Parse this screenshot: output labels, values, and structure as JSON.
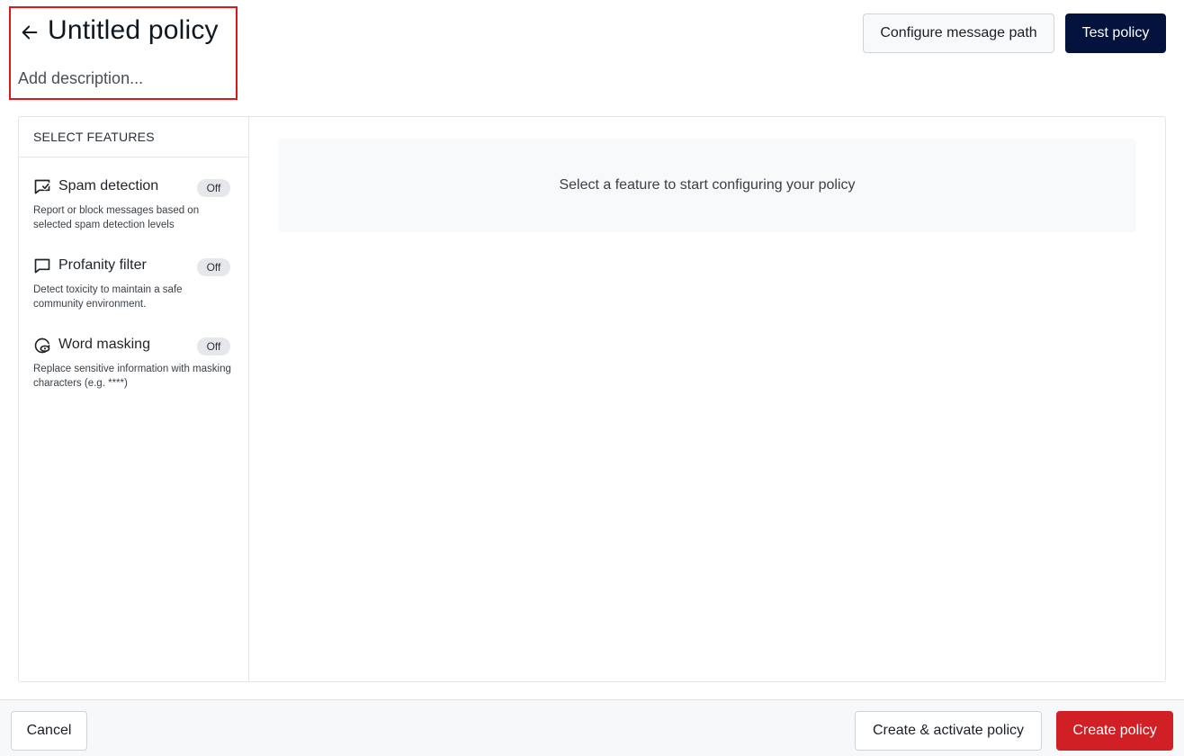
{
  "header": {
    "title": "Untitled policy",
    "description_placeholder": "Add description...",
    "back_icon": "arrow-left-icon"
  },
  "actions": {
    "configure_message_path": "Configure message path",
    "test_policy": "Test policy"
  },
  "sidebar": {
    "heading": "SELECT FEATURES",
    "features": [
      {
        "name": "Spam detection",
        "status": "Off",
        "description": "Report or block messages based on selected spam detection levels",
        "icon": "message-check-icon"
      },
      {
        "name": "Profanity filter",
        "status": "Off",
        "description": "Detect toxicity to maintain a safe community environment.",
        "icon": "message-square-icon"
      },
      {
        "name": "Word masking",
        "status": "Off",
        "description": "Replace sensitive information with masking characters (e.g. ****)",
        "icon": "eye-mask-icon"
      }
    ]
  },
  "main": {
    "empty_state": "Select a feature to start configuring your policy"
  },
  "footer": {
    "cancel": "Cancel",
    "create_and_activate": "Create & activate policy",
    "create": "Create policy"
  },
  "colors": {
    "primary_dark": "#03133d",
    "danger": "#d11f26",
    "highlight_border": "#e0161b"
  }
}
